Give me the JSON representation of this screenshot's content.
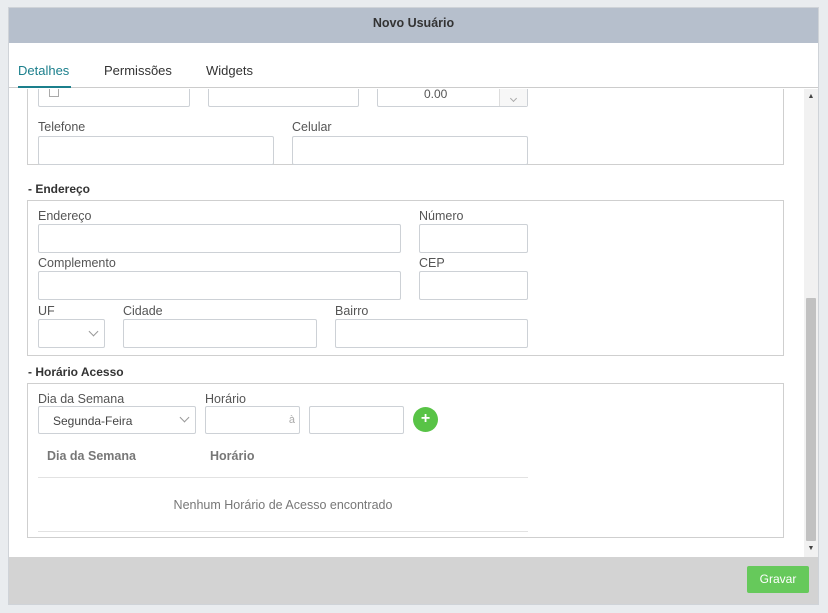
{
  "modal": {
    "title": "Novo Usuário"
  },
  "tabs": [
    {
      "label": "Detalhes",
      "active": true
    },
    {
      "label": "Permissões",
      "active": false
    },
    {
      "label": "Widgets",
      "active": false
    }
  ],
  "top_fields": {
    "salary_value": "0.00"
  },
  "contact": {
    "phone_label": "Telefone",
    "mobile_label": "Celular"
  },
  "address": {
    "section_title": "- Endereço",
    "street_label": "Endereço",
    "number_label": "Número",
    "complement_label": "Complemento",
    "zip_label": "CEP",
    "state_label": "UF",
    "city_label": "Cidade",
    "district_label": "Bairro"
  },
  "access": {
    "section_title": "- Horário Acesso",
    "weekday_label": "Dia da Semana",
    "weekday_value": "Segunda-Feira",
    "time_label": "Horário",
    "range_separator": "à",
    "table_headers": [
      "Dia da Semana",
      "Horário"
    ],
    "empty_message": "Nenhum Horário de Acesso encontrado",
    "add_symbol": "+"
  },
  "footer": {
    "save_label": "Gravar"
  },
  "colors": {
    "accent": "#1b7f8c",
    "save": "#66c95b",
    "add": "#58c346",
    "header": "#b6bfcc"
  }
}
